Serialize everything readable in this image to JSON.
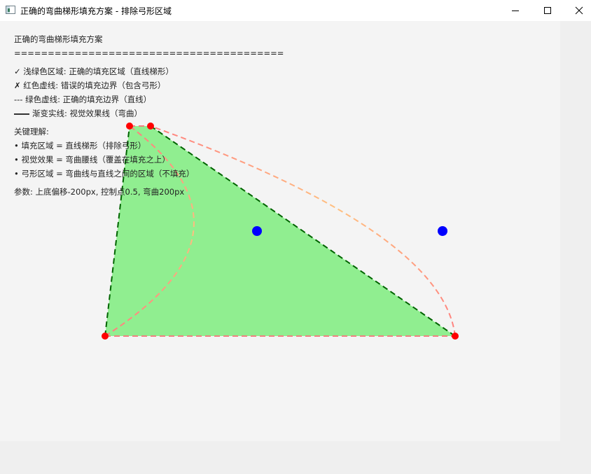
{
  "window": {
    "title": "正确的弯曲梯形填充方案 - 排除弓形区域",
    "icon": "app-window-icon",
    "controls": {
      "minimize_icon": "minimize-icon",
      "maximize_icon": "maximize-icon",
      "close_icon": "close-icon"
    }
  },
  "info": {
    "heading": "正确的弯曲梯形填充方案",
    "separator": "========================================",
    "legend": [
      "✓ 浅绿色区域: 正确的填充区域（直线梯形）",
      "✗ 红色虚线: 错误的填充边界（包含弓形）",
      "--- 绿色虚线: 正确的填充边界（直线）",
      "渐变实线: 视觉效果线（弯曲）"
    ],
    "key_heading": "关键理解:",
    "key_points": [
      "• 填充区域 = 直线梯形（排除弓形）",
      "• 视觉效果 = 弯曲腰线（覆盖在填充之上）",
      "• 弓形区域 = 弯曲线与直线之间的区域（不填充）"
    ],
    "params": "参数: 上底偏移-200px, 控制点0.5, 弯曲200px"
  },
  "colors": {
    "fill": "#90ee90",
    "green_dashed": "#006400",
    "red_dashed": "#f08080",
    "gradient_start": "#ff7f7f",
    "gradient_end": "#ffc080",
    "vertex": "#ff0000",
    "control_point": "#0000ff",
    "canvas_bg": "#f4f4f4"
  }
}
